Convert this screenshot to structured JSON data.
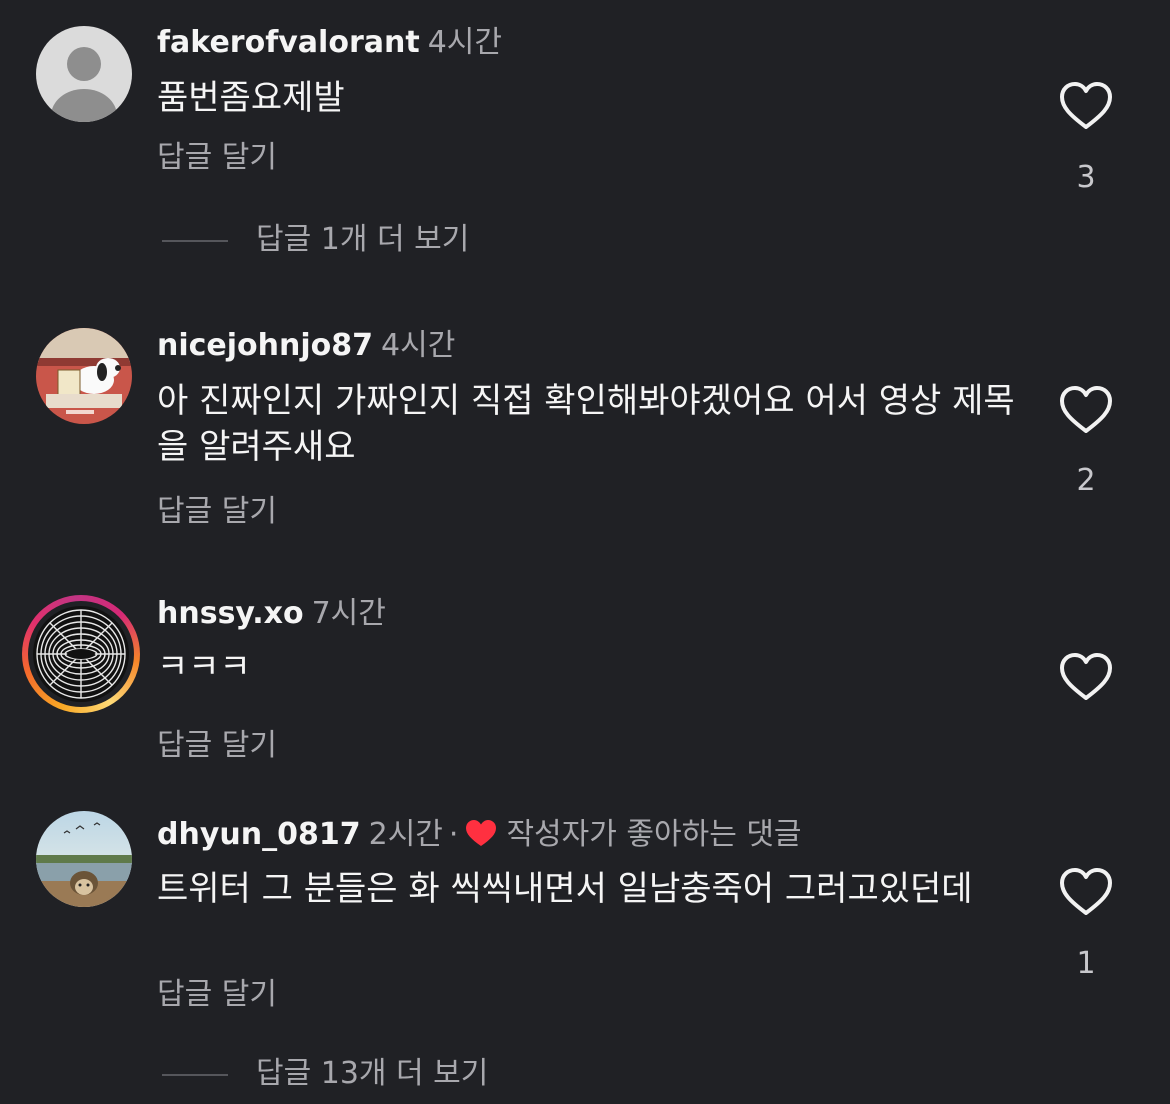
{
  "colors": {
    "background": "#202125",
    "primary_text": "#f5f5f5",
    "secondary_text": "#a8a8ad",
    "creator_like_heart": "#ff3040"
  },
  "comments": [
    {
      "username": "fakerofvalorant",
      "time": "4시간",
      "text": "품번좀요제발",
      "reply_label": "답글 달기",
      "likes": "3",
      "more_replies": "답글 1개 더 보기",
      "avatar": "default-avatar-icon"
    },
    {
      "username": "nicejohnjo87",
      "time": "4시간",
      "text": "아 진짜인지 가짜인지 직접 확인해봐야겠어요 어서 영상 제목을 알려주새요",
      "reply_label": "답글 달기",
      "likes": "2",
      "avatar": "snoopy-avatar"
    },
    {
      "username": "hnssy.xo",
      "time": "7시간",
      "text": "ㅋㅋㅋ",
      "reply_label": "답글 달기",
      "likes": "",
      "avatar": "spiral-avatar-with-story-ring"
    },
    {
      "username": "dhyun_0817",
      "time": "2시간",
      "separator": "·",
      "creator_liked_label": "작성자가 좋아하는 댓글",
      "text": "트위터 그 분들은 화 씩씩내면서 일남충죽어 그러고있던데",
      "reply_label": "답글 달기",
      "likes": "1",
      "more_replies": "답글 13개 더 보기",
      "avatar": "hedgehog-landscape-avatar"
    }
  ]
}
